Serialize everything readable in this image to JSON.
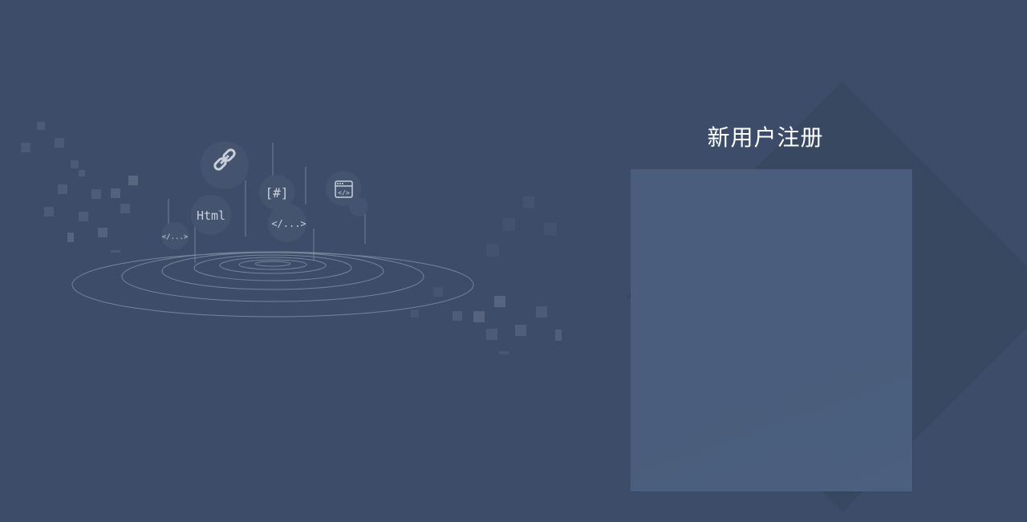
{
  "page": {
    "background": "#3d4d69"
  },
  "illustration": {
    "icons": [
      {
        "name": "link-icon",
        "label": ""
      },
      {
        "name": "html-icon",
        "label": "Html"
      },
      {
        "name": "hash-icon",
        "label": "[#]"
      },
      {
        "name": "code-tag-icon",
        "label": "</...>"
      },
      {
        "name": "browser-code-icon",
        "label": "</>"
      },
      {
        "name": "small-code-tag-icon",
        "label": "</...>"
      }
    ]
  },
  "register": {
    "title": "新用户注册",
    "panel_color": "#4a5d7c"
  }
}
